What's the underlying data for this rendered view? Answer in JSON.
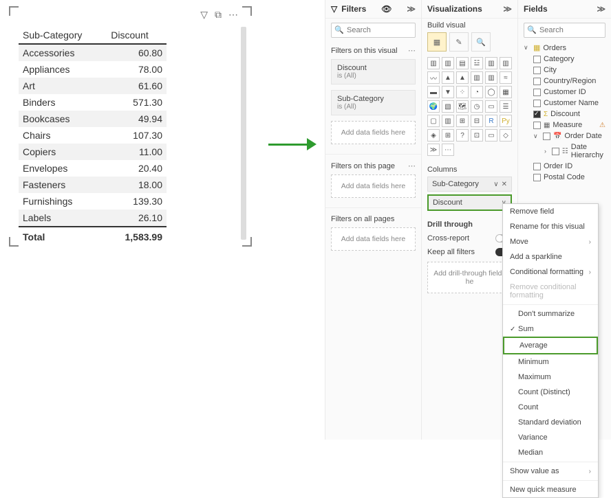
{
  "table": {
    "headers": [
      "Sub-Category",
      "Discount"
    ],
    "rows": [
      {
        "cat": "Accessories",
        "val": "60.80"
      },
      {
        "cat": "Appliances",
        "val": "78.00"
      },
      {
        "cat": "Art",
        "val": "61.60"
      },
      {
        "cat": "Binders",
        "val": "571.30"
      },
      {
        "cat": "Bookcases",
        "val": "49.94"
      },
      {
        "cat": "Chairs",
        "val": "107.30"
      },
      {
        "cat": "Copiers",
        "val": "11.00"
      },
      {
        "cat": "Envelopes",
        "val": "20.40"
      },
      {
        "cat": "Fasteners",
        "val": "18.00"
      },
      {
        "cat": "Furnishings",
        "val": "139.30"
      },
      {
        "cat": "Labels",
        "val": "26.10"
      }
    ],
    "total_label": "Total",
    "total_value": "1,583.99"
  },
  "filters": {
    "title": "Filters",
    "search_ph": "Search",
    "on_visual": "Filters on this visual",
    "card1_name": "Discount",
    "card1_cond": "is (All)",
    "card2_name": "Sub-Category",
    "card2_cond": "is (All)",
    "add": "Add data fields here",
    "on_page": "Filters on this page",
    "on_all": "Filters on all pages"
  },
  "viz": {
    "title": "Visualizations",
    "build": "Build visual",
    "columns": "Columns",
    "well1": "Sub-Category",
    "well2": "Discount",
    "drill": "Drill through",
    "cross": "Cross-report",
    "keep": "Keep all filters",
    "add_drill": "Add drill-through fields he"
  },
  "fields": {
    "title": "Fields",
    "search_ph": "Search",
    "table": "Orders",
    "items": {
      "category": "Category",
      "city": "City",
      "country": "Country/Region",
      "customer_id": "Customer ID",
      "customer_name": "Customer Name",
      "discount": "Discount",
      "measure": "Measure",
      "order_date": "Order Date",
      "date_hier": "Date Hierarchy",
      "order_id": "Order ID",
      "postal": "Postal Code"
    }
  },
  "menu": {
    "remove_field": "Remove field",
    "rename": "Rename for this visual",
    "move": "Move",
    "sparkline": "Add a sparkline",
    "cond": "Conditional formatting",
    "remove_cond": "Remove conditional formatting",
    "dont": "Don't summarize",
    "sum": "Sum",
    "avg": "Average",
    "min": "Minimum",
    "max": "Maximum",
    "count_d": "Count (Distinct)",
    "count": "Count",
    "std": "Standard deviation",
    "variance": "Variance",
    "median": "Median",
    "show_as": "Show value as",
    "new_quick": "New quick measure"
  }
}
